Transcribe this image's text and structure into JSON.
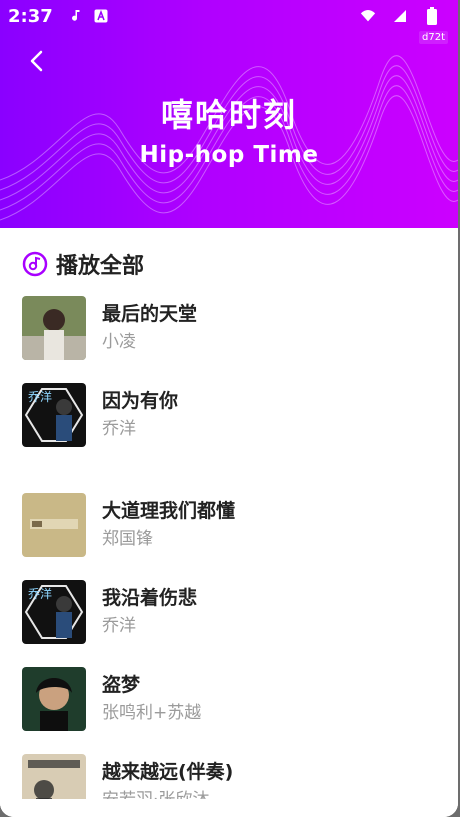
{
  "status": {
    "time": "2:37",
    "tag": "d72t"
  },
  "header": {
    "title_cn": "嘻哈时刻",
    "title_en": "Hip-hop Time"
  },
  "playall": {
    "label": "播放全部"
  },
  "songs": [
    {
      "title": "最后的天堂",
      "artist": "小凌"
    },
    {
      "title": "因为有你",
      "artist": "乔洋"
    },
    {
      "title": "大道理我们都懂",
      "artist": "郑国锋"
    },
    {
      "title": "我沿着伤悲",
      "artist": "乔洋"
    },
    {
      "title": "盗梦",
      "artist": "张鸣利+苏越"
    },
    {
      "title": "越来越远(伴奏)",
      "artist": "安若羽·张欣沐"
    }
  ],
  "colors": {
    "accent": "#a800ff",
    "brand_start": "#8a00ff",
    "brand_end": "#cc00ff"
  }
}
